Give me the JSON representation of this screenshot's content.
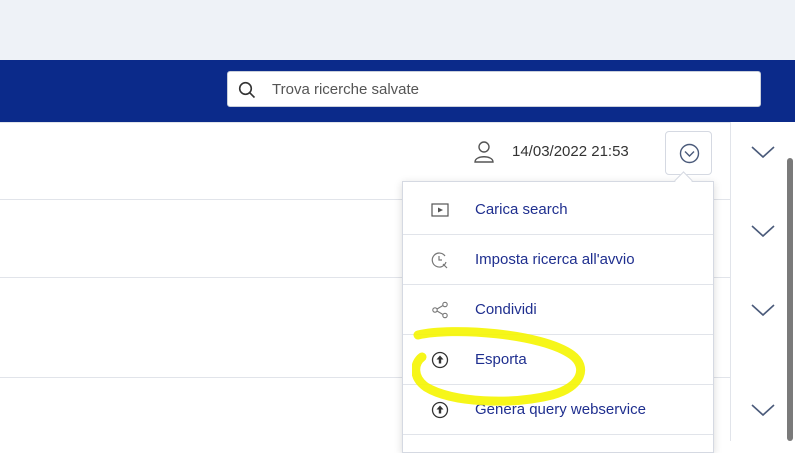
{
  "search": {
    "placeholder": "Trova ricerche salvate"
  },
  "row": {
    "date": "14/03/2022 21:53"
  },
  "menu": {
    "items": [
      {
        "label": "Carica search",
        "icon": "play-icon"
      },
      {
        "label": "Imposta ricerca all'avvio",
        "icon": "clock-search-icon"
      },
      {
        "label": "Condividi",
        "icon": "share-icon"
      },
      {
        "label": "Esporta",
        "icon": "upload-circle-icon"
      },
      {
        "label": "Genera query webservice",
        "icon": "upload-circle-icon"
      }
    ]
  },
  "colors": {
    "header": "#0b2a8a",
    "menu_text": "#1f2f8f",
    "highlight": "#f5f500"
  }
}
